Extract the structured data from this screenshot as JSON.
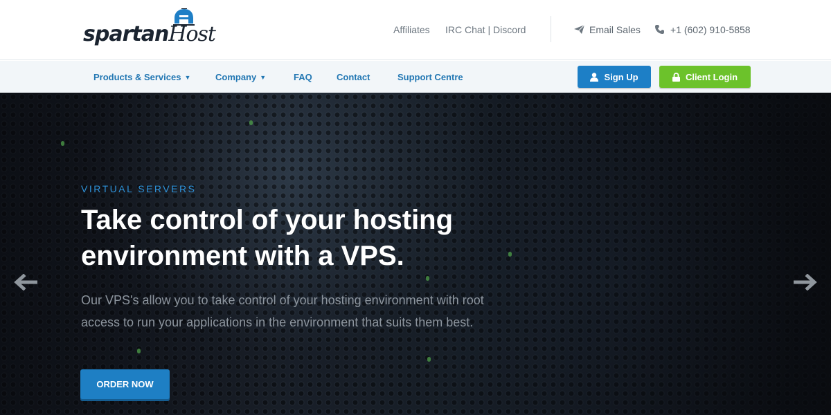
{
  "brand": {
    "logo_text_1": "spartan",
    "logo_text_2": "Host"
  },
  "top_links": [
    {
      "label": "Affiliates"
    },
    {
      "label": "IRC Chat | Discord"
    }
  ],
  "top_contact": {
    "email_label": "Email Sales",
    "phone_label": "+1 (602) 910-5858",
    "email_icon": "paper-plane-icon",
    "phone_icon": "phone-icon"
  },
  "nav": {
    "items": [
      {
        "label": "Products & Services",
        "has_dropdown": true
      },
      {
        "label": "Company",
        "has_dropdown": true
      },
      {
        "label": "FAQ",
        "has_dropdown": false
      },
      {
        "label": "Contact",
        "has_dropdown": false
      },
      {
        "label": "Support Centre",
        "has_dropdown": false
      }
    ],
    "signup_label": "Sign Up",
    "login_label": "Client Login"
  },
  "hero": {
    "kicker": "VIRTUAL SERVERS",
    "title": "Take control of your hosting environment with a VPS.",
    "body": "Our VPS's allow you to take control of your hosting environment with root access to run your applications in the environment that suits them best.",
    "cta_label": "ORDER NOW"
  },
  "colors": {
    "accent_blue": "#1d7fc6",
    "accent_green": "#6cc22b",
    "nav_text": "#2277b3",
    "kicker_blue": "#2e92d9"
  }
}
